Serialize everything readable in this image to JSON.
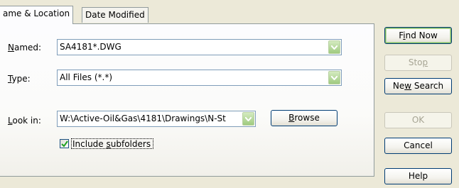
{
  "tabs": {
    "active": "ame & Location",
    "inactive": "Date Modified"
  },
  "form": {
    "named_label": "Named:",
    "named_value": "SA4181*.DWG",
    "type_label": "Type:",
    "type_value": "All Files (*.*)",
    "lookin_label": "Look in:",
    "lookin_value": "W:\\Active-Oil&Gas\\4181\\Drawings\\N-St",
    "browse_label": "Browse",
    "subfolders_label": "Include subfolders",
    "subfolders_checked": true
  },
  "buttons": {
    "find_now": "Find Now",
    "stop": "Stop",
    "new_search": "New Search",
    "ok": "OK",
    "cancel": "Cancel",
    "help": "Help"
  },
  "colors": {
    "dialog_bg": "#ece9d8",
    "button_border": "#003c74",
    "combo_arrow": "#9fca7f"
  }
}
